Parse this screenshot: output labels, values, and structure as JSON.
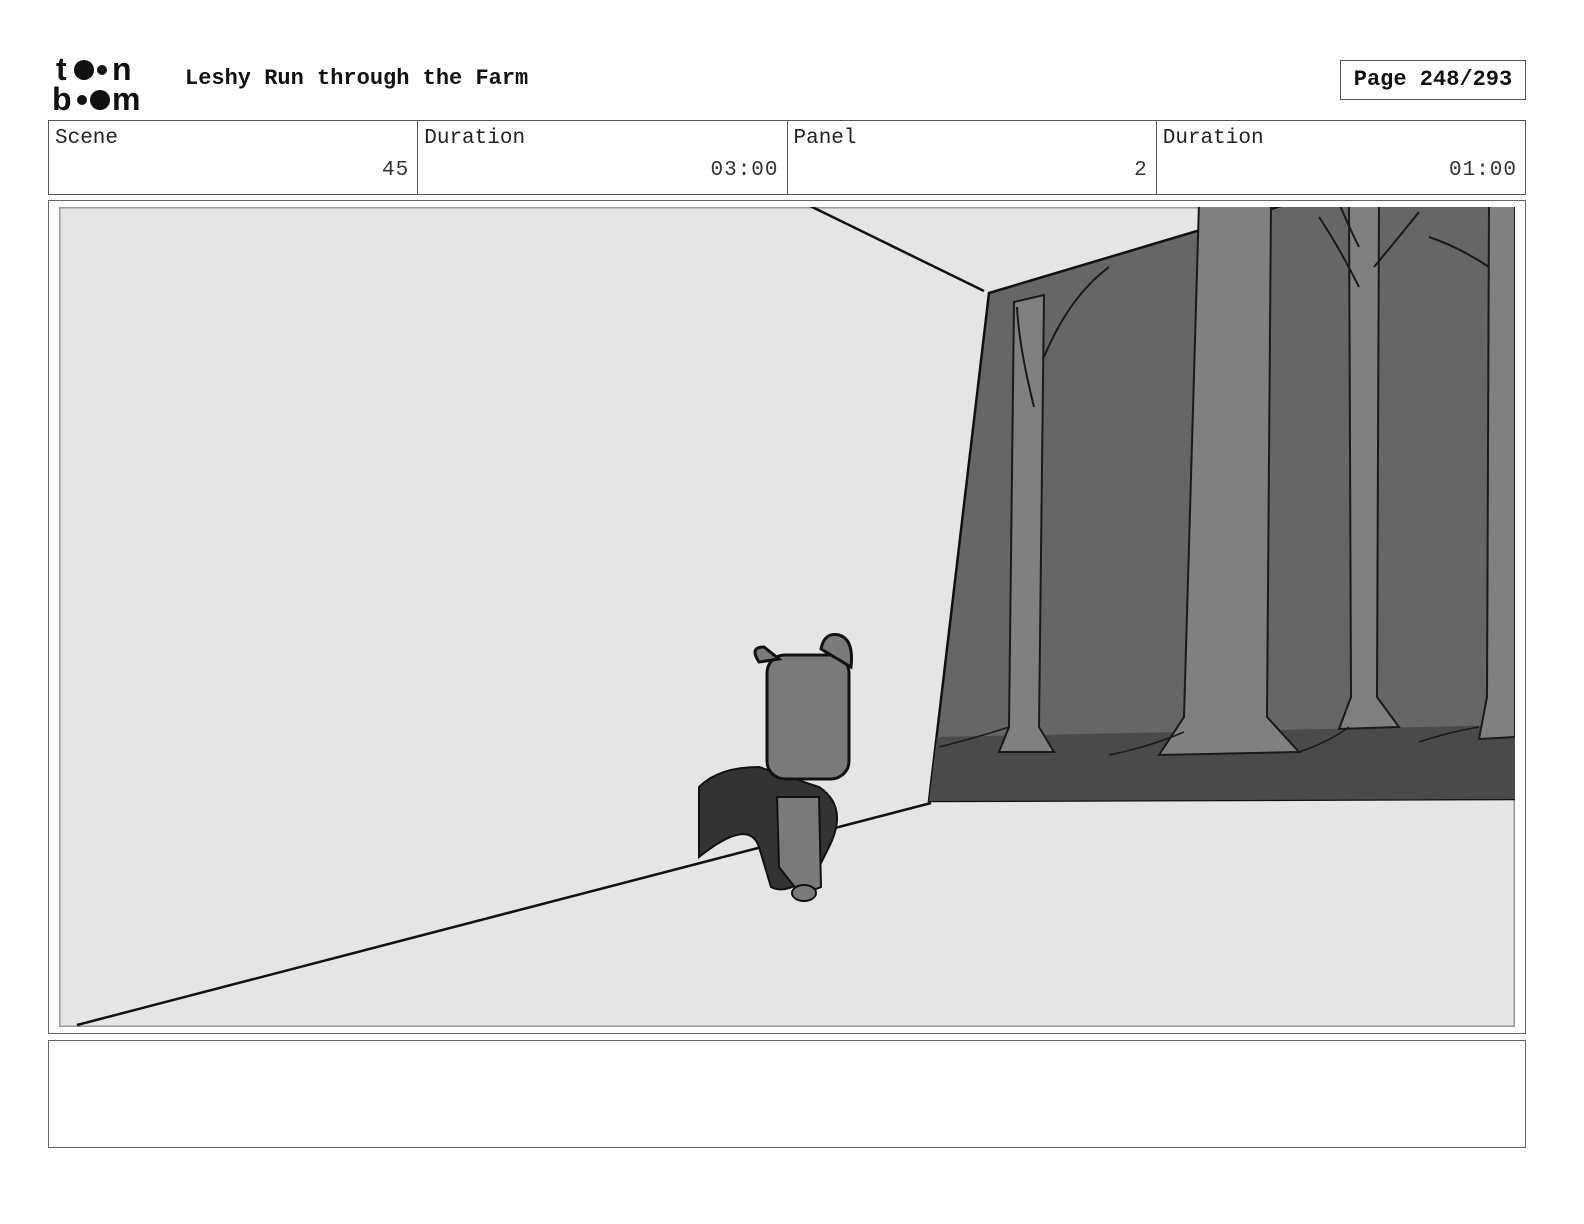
{
  "header": {
    "logo_name": "toon boom",
    "title": "Leshy Run through the Farm",
    "page": "Page 248/293"
  },
  "info": {
    "scene_label": "Scene",
    "scene_value": "45",
    "scene_duration_label": "Duration",
    "scene_duration_value": "03:00",
    "panel_label": "Panel",
    "panel_value": "2",
    "panel_duration_label": "Duration",
    "panel_duration_value": "01:00"
  },
  "notes": {
    "text": ""
  },
  "colors": {
    "panel_bg": "#e5e5e5",
    "forest_bg": "#666666",
    "forest_floor": "#4a4a4a",
    "tree_trunk": "#808080",
    "character": "#7a7a7a",
    "cloak": "#333333"
  }
}
